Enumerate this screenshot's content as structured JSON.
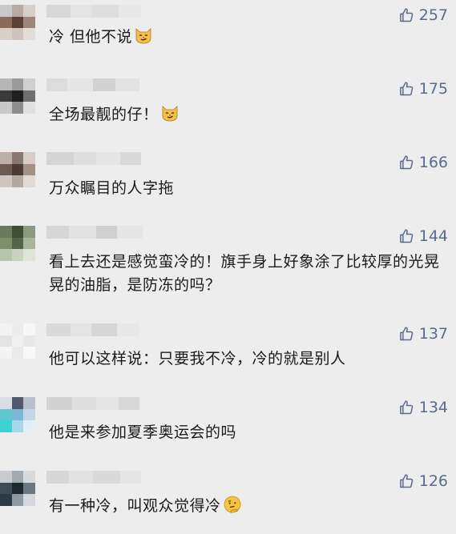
{
  "comments": [
    {
      "likes": "257",
      "text": "冷 但他不说",
      "emoji": "smirk-cat-face",
      "avatar_colors": [
        "#c9c9c9",
        "#b8aaa0",
        "#d6d0cc",
        "#8a6a58",
        "#5a4035",
        "#9c857a",
        "#d8cfc8",
        "#cfc4bc",
        "#e2dcd8"
      ],
      "name_colors": [
        "#d8d8d8",
        "#e4e4e4",
        "#dedede",
        "#e8e8e8"
      ]
    },
    {
      "likes": "175",
      "text": "全场最靓的仔！",
      "emoji": "smirk-cat-face",
      "avatar_colors": [
        "#b5b5b5",
        "#9a9a9a",
        "#cfcfcf",
        "#3a3a3a",
        "#1f1f1f",
        "#6e6e6e",
        "#c8c8c8",
        "#8d8d8d",
        "#e0e0e0"
      ],
      "name_colors": [
        "#dcdcdc",
        "#e6e6e6",
        "#d2d2d2",
        "#e3e3e3"
      ]
    },
    {
      "likes": "166",
      "text": "万众瞩目的人字拖",
      "emoji": "",
      "avatar_colors": [
        "#bdb0a8",
        "#8a7870",
        "#d6cdc8",
        "#6f5a52",
        "#4d3a34",
        "#a28f86",
        "#cfc6c0",
        "#b5a8a0",
        "#e0dad6"
      ],
      "name_colors": [
        "#d4d4d4",
        "#dedede",
        "#e6e6e6",
        "#dadada"
      ]
    },
    {
      "likes": "144",
      "text": "看上去还是感觉蛮冷的！旗手身上好象涂了比较厚的光晃晃的油脂，是防冻的吗？",
      "emoji": "",
      "avatar_colors": [
        "#6a7a5a",
        "#3f4f36",
        "#8a9a7a",
        "#7f8f6c",
        "#556348",
        "#a8b59a",
        "#b9c4ad",
        "#c9d1bf",
        "#dfe4d9"
      ],
      "name_colors": [
        "#d6d6d6",
        "#e2e2e2",
        "#cfcfcf",
        "#e6e6e6"
      ]
    },
    {
      "likes": "137",
      "text": "他可以这样说：只要我不冷，冷的就是别人",
      "emoji": "",
      "avatar_colors": [
        "#f2f2f2",
        "#ececec",
        "#f6f6f6",
        "#e4e4e4",
        "#f0f0f0",
        "#e8e8e8",
        "#f4f4f4",
        "#eaeaea",
        "#f8f8f8"
      ],
      "name_colors": [
        "#dadada",
        "#e4e4e4",
        "#d6d6d6",
        "#e8e8e8"
      ]
    },
    {
      "likes": "134",
      "text": "他是来参加夏季奥运会的吗",
      "emoji": "",
      "avatar_colors": [
        "#d9dde3",
        "#4f5a6e",
        "#b9c0cc",
        "#5ec7d0",
        "#7ab8d6",
        "#c7d6e4",
        "#3dd1d6",
        "#a8d8e6",
        "#e4eef4"
      ],
      "name_colors": [
        "#d2d2d2",
        "#dedede",
        "#e6e6e6",
        "#d8d8d8"
      ]
    },
    {
      "likes": "126",
      "text": "有一种冷，叫观众觉得冷",
      "emoji": "thinking-face",
      "avatar_colors": [
        "#c8ccd0",
        "#a3a9b0",
        "#d8dbde",
        "#3f4a55",
        "#1e2830",
        "#6d7780",
        "#2d3a45",
        "#8e99a3",
        "#d4d8dc"
      ],
      "name_colors": [
        "#d6d6d6",
        "#e2e2e2",
        "#dadada",
        "#e6e6e6"
      ]
    }
  ],
  "colors": {
    "background": "#ededed",
    "like_color": "#5b6b8c",
    "text_color": "#1a1a1a"
  }
}
